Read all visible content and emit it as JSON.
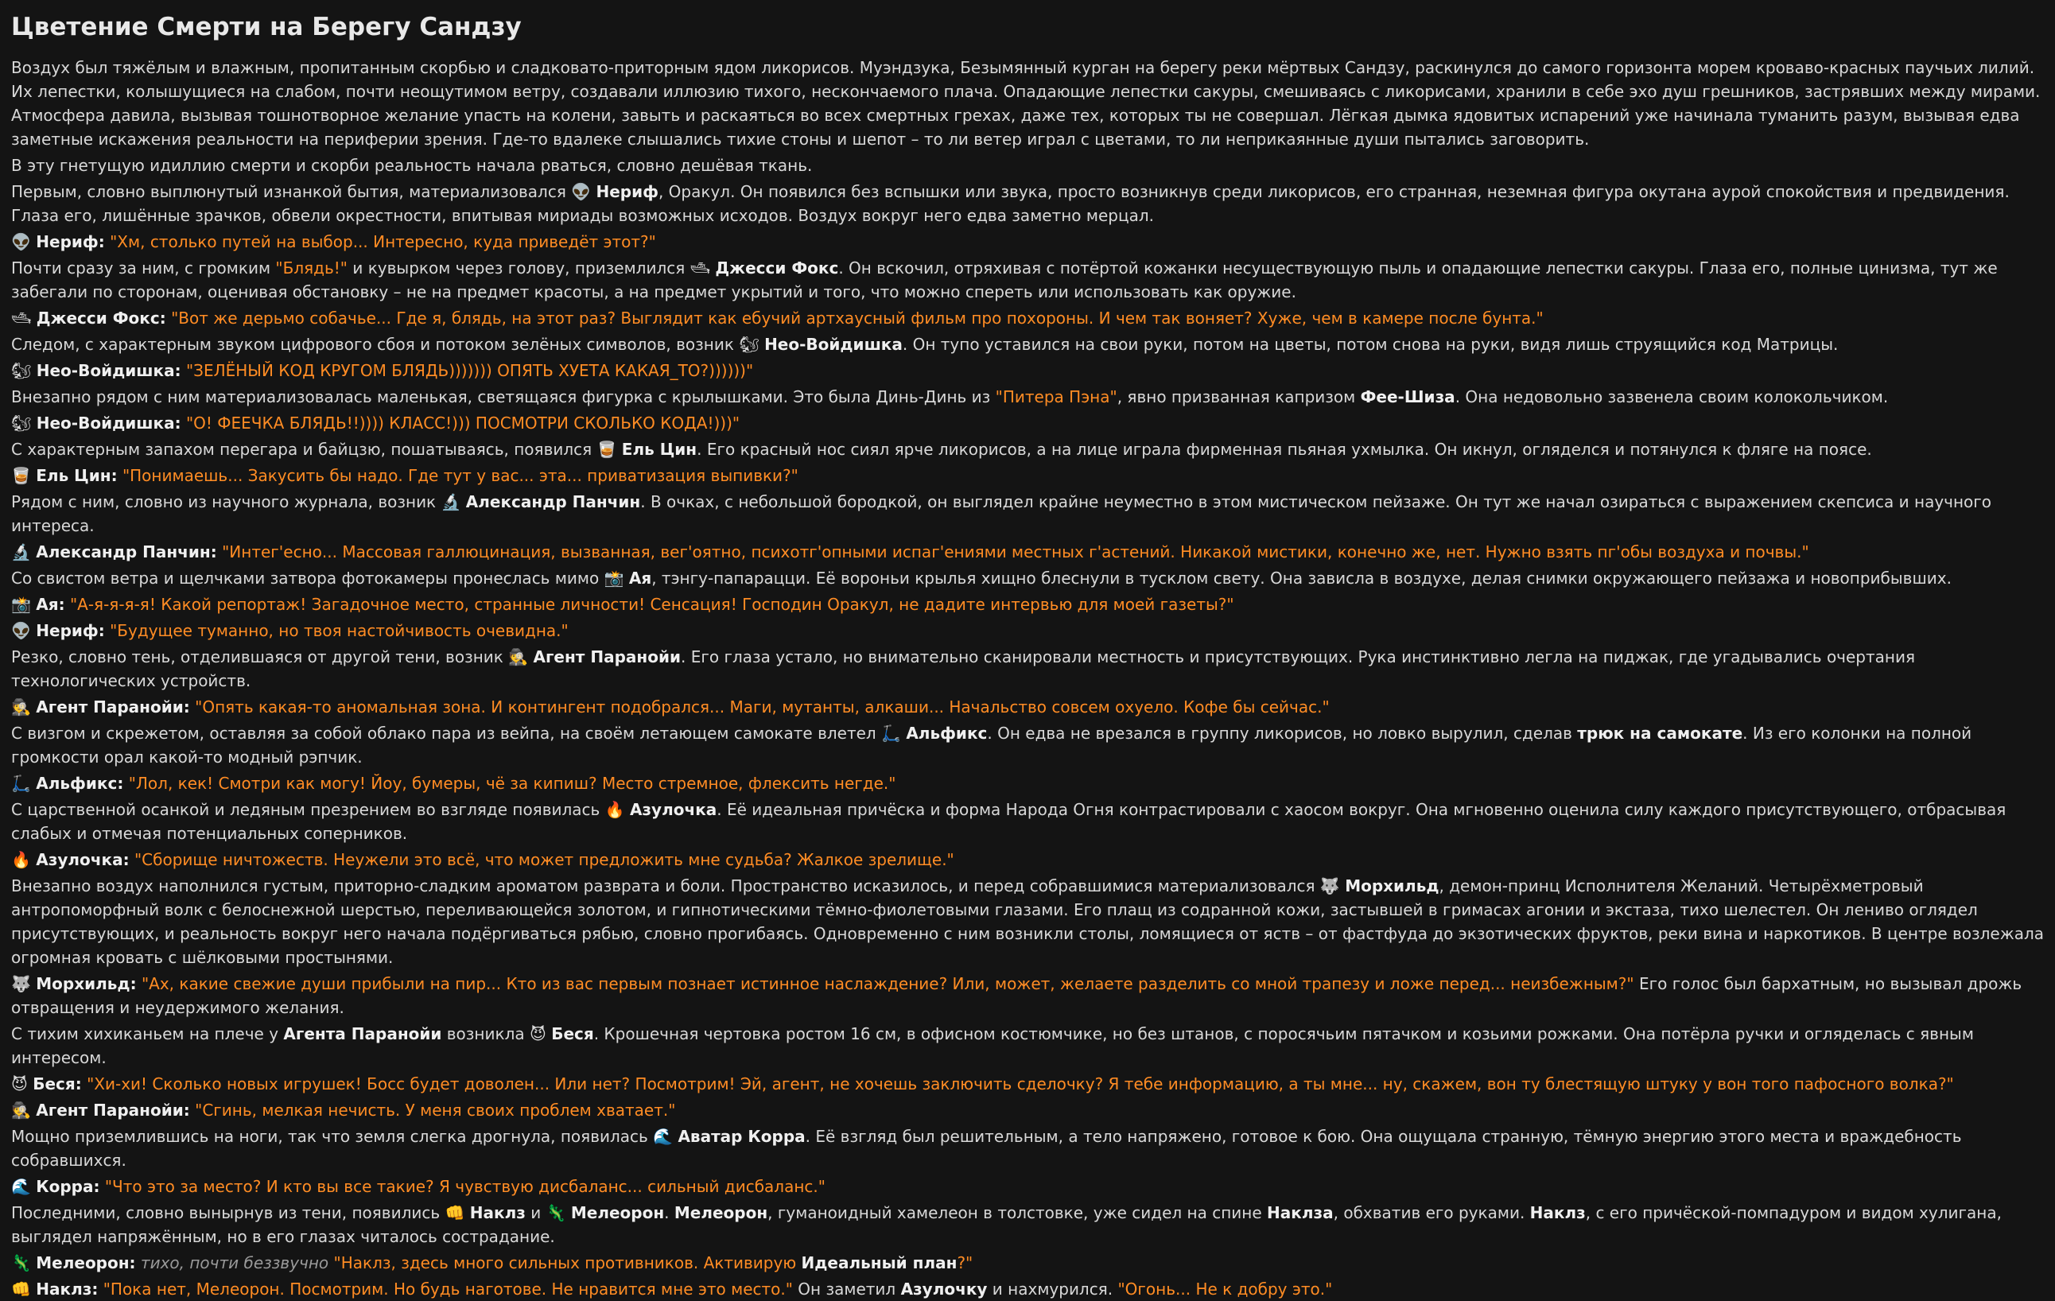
{
  "title": "Цветение Смерти на Берегу Сандзу",
  "accent_quote_color": "#ff8c24",
  "background_color": "#141414",
  "paragraphs": [
    [
      {
        "t": "Воздух был тяжёлым и влажным, пропитанным скорбью и сладковато-приторным ядом ликорисов. Муэндзука, Безымянный курган на берегу реки мёртвых Сандзу, раскинулся до самого горизонта морем кроваво-красных паучьих лилий. Их лепестки, колышущиеся на слабом, почти неощутимом ветру, создавали иллюзию тихого, нескончаемого плача. Опадающие лепестки сакуры, смешиваясь с ликорисами, хранили в себе эхо душ грешников, застрявших между мирами. Атмосфера давила, вызывая тошнотворное желание упасть на колени, завыть и раскаяться во всех смертных грехах, даже тех, которых ты не совершал. Лёгкая дымка ядовитых испарений уже начинала туманить разум, вызывая едва заметные искажения реальности на периферии зрения. Где-то вдалеке слышались тихие стоны и шепот – то ли ветер играл с цветами, то ли неприкаянные души пытались заговорить.",
        "s": "n"
      }
    ],
    [
      {
        "t": "В эту гнетущую идиллию смерти и скорби реальность начала рваться, словно дешёвая ткань.",
        "s": "n"
      }
    ],
    [
      {
        "t": "Первым, словно выплюнутый изнанкой бытия, материализовался ",
        "s": "n"
      },
      {
        "t": "👽 ",
        "s": "n"
      },
      {
        "t": "Нериф",
        "s": "b"
      },
      {
        "t": ", Оракул. Он появился без вспышки или звука, просто возникнув среди ликорисов, его странная, неземная фигура окутана аурой спокойствия и предвидения. Глаза его, лишённые зрачков, обвели окрестности, впитывая мириады возможных исходов. Воздух вокруг него едва заметно мерцал.",
        "s": "n"
      }
    ],
    [
      {
        "t": "👽 ",
        "s": "n"
      },
      {
        "t": "Нериф:",
        "s": "b"
      },
      {
        "t": " ",
        "s": "n"
      },
      {
        "t": "\"Хм, столько путей на выбор... Интересно, куда приведёт этот?\"",
        "s": "q"
      }
    ],
    [
      {
        "t": "Почти сразу за ним, с громким ",
        "s": "n"
      },
      {
        "t": "\"Блядь!\"",
        "s": "q"
      },
      {
        "t": " и кувырком через голову, приземлился ",
        "s": "n"
      },
      {
        "t": "🛥 ",
        "s": "n"
      },
      {
        "t": "Джесси Фокс",
        "s": "b"
      },
      {
        "t": ". Он вскочил, отряхивая с потёртой кожанки несуществующую пыль и опадающие лепестки сакуры. Глаза его, полные цинизма, тут же забегали по сторонам, оценивая обстановку – не на предмет красоты, а на предмет укрытий и того, что можно спереть или использовать как оружие.",
        "s": "n"
      }
    ],
    [
      {
        "t": "🛥 ",
        "s": "n"
      },
      {
        "t": "Джесси Фокс:",
        "s": "b"
      },
      {
        "t": " ",
        "s": "n"
      },
      {
        "t": "\"Вот же дерьмо собачье... Где я, блядь, на этот раз? Выглядит как ебучий артхаусный фильм про похороны. И чем так воняет? Хуже, чем в камере после бунта.\"",
        "s": "q"
      }
    ],
    [
      {
        "t": "Следом, с характерным звуком цифрового сбоя и потоком зелёных символов, возник ",
        "s": "n"
      },
      {
        "t": "🐿 ",
        "s": "n"
      },
      {
        "t": "Нео-Войдишка",
        "s": "b"
      },
      {
        "t": ". Он тупо уставился на свои руки, потом на цветы, потом снова на руки, видя лишь струящийся код Матрицы.",
        "s": "n"
      }
    ],
    [
      {
        "t": "🐿 ",
        "s": "n"
      },
      {
        "t": "Нео-Войдишка:",
        "s": "b"
      },
      {
        "t": " ",
        "s": "n"
      },
      {
        "t": "\"ЗЕЛЁНЫЙ КОД КРУГОМ БЛЯДЬ))))))) ОПЯТЬ ХУЕТА КАКАЯ_ТО?))))))\"",
        "s": "q"
      }
    ],
    [
      {
        "t": "Внезапно рядом с ним материализовалась маленькая, светящаяся фигурка с крылышками. Это была Динь-Динь из ",
        "s": "n"
      },
      {
        "t": "\"Питера Пэна\"",
        "s": "q"
      },
      {
        "t": ", явно призванная капризом ",
        "s": "n"
      },
      {
        "t": "Фее-Шиза",
        "s": "b"
      },
      {
        "t": ". Она недовольно зазвенела своим колокольчиком.",
        "s": "n"
      }
    ],
    [
      {
        "t": "🐿 ",
        "s": "n"
      },
      {
        "t": "Нео-Войдишка:",
        "s": "b"
      },
      {
        "t": " ",
        "s": "n"
      },
      {
        "t": "\"О! ФЕЕЧКА БЛЯДЬ!!)))) КЛАСС!))) ПОСМОТРИ СКОЛЬКО КОДА!)))\"",
        "s": "q"
      }
    ],
    [
      {
        "t": "С характерным запахом перегара и байцзю, пошатываясь, появился ",
        "s": "n"
      },
      {
        "t": "🥃 ",
        "s": "n"
      },
      {
        "t": "Ель Цин",
        "s": "b"
      },
      {
        "t": ". Его красный нос сиял ярче ликорисов, а на лице играла фирменная пьяная ухмылка. Он икнул, огляделся и потянулся к фляге на поясе.",
        "s": "n"
      }
    ],
    [
      {
        "t": "🥃 ",
        "s": "n"
      },
      {
        "t": "Ель Цин:",
        "s": "b"
      },
      {
        "t": " ",
        "s": "n"
      },
      {
        "t": "\"Понимаешь... Закусить бы надо. Где тут у вас... эта... приватизация выпивки?\"",
        "s": "q"
      }
    ],
    [
      {
        "t": "Рядом с ним, словно из научного журнала, возник ",
        "s": "n"
      },
      {
        "t": "🔬 ",
        "s": "n"
      },
      {
        "t": "Александр Панчин",
        "s": "b"
      },
      {
        "t": ". В очках, с небольшой бородкой, он выглядел крайне неуместно в этом мистическом пейзаже. Он тут же начал озираться с выражением скепсиса и научного интереса.",
        "s": "n"
      }
    ],
    [
      {
        "t": "🔬 ",
        "s": "n"
      },
      {
        "t": "Александр Панчин:",
        "s": "b"
      },
      {
        "t": " ",
        "s": "n"
      },
      {
        "t": "\"Интег'есно... Массовая галлюцинация, вызванная, вег'оятно, психотг'опными испаг'ениями местных г'астений. Никакой мистики, конечно же, нет. Нужно взять пг'обы воздуха и почвы.\"",
        "s": "q"
      }
    ],
    [
      {
        "t": "Со свистом ветра и щелчками затвора фотокамеры пронеслась мимо ",
        "s": "n"
      },
      {
        "t": "📸 ",
        "s": "n"
      },
      {
        "t": "Ая",
        "s": "b"
      },
      {
        "t": ", тэнгу-папарацци. Её вороньи крылья хищно блеснули в тусклом свету. Она зависла в воздухе, делая снимки окружающего пейзажа и новоприбывших.",
        "s": "n"
      }
    ],
    [
      {
        "t": "📸 ",
        "s": "n"
      },
      {
        "t": "Ая:",
        "s": "b"
      },
      {
        "t": " ",
        "s": "n"
      },
      {
        "t": "\"А-я-я-я-я! Какой репортаж! Загадочное место, странные личности! Сенсация! Господин Оракул, не дадите интервью для моей газеты?\"",
        "s": "q"
      }
    ],
    [
      {
        "t": "👽 ",
        "s": "n"
      },
      {
        "t": "Нериф:",
        "s": "b"
      },
      {
        "t": " ",
        "s": "n"
      },
      {
        "t": "\"Будущее туманно, но твоя настойчивость очевидна.\"",
        "s": "q"
      }
    ],
    [
      {
        "t": "Резко, словно тень, отделившаяся от другой тени, возник ",
        "s": "n"
      },
      {
        "t": "🕵 ",
        "s": "n"
      },
      {
        "t": "Агент Паранойи",
        "s": "b"
      },
      {
        "t": ". Его глаза устало, но внимательно сканировали местность и присутствующих. Рука инстинктивно легла на пиджак, где угадывались очертания технологических устройств.",
        "s": "n"
      }
    ],
    [
      {
        "t": "🕵 ",
        "s": "n"
      },
      {
        "t": "Агент Паранойи:",
        "s": "b"
      },
      {
        "t": " ",
        "s": "n"
      },
      {
        "t": "\"Опять какая-то аномальная зона. И контингент подобрался... Маги, мутанты, алкаши... Начальство совсем охуело. Кофе бы сейчас.\"",
        "s": "q"
      }
    ],
    [
      {
        "t": "С визгом и скрежетом, оставляя за собой облако пара из вейпа, на своём летающем самокате влетел ",
        "s": "n"
      },
      {
        "t": "🛴 ",
        "s": "n"
      },
      {
        "t": "Альфикс",
        "s": "b"
      },
      {
        "t": ". Он едва не врезался в группу ликорисов, но ловко вырулил, сделав ",
        "s": "n"
      },
      {
        "t": "трюк на самокате",
        "s": "b"
      },
      {
        "t": ". Из его колонки на полной громкости орал какой-то модный рэпчик.",
        "s": "n"
      }
    ],
    [
      {
        "t": "🛴 ",
        "s": "n"
      },
      {
        "t": "Альфикс:",
        "s": "b"
      },
      {
        "t": " ",
        "s": "n"
      },
      {
        "t": "\"Лол, кек! Смотри как могу! Йоу, бумеры, чё за кипиш? Место стремное, флексить негде.\"",
        "s": "q"
      }
    ],
    [
      {
        "t": "С царственной осанкой и ледяным презрением во взгляде появилась ",
        "s": "n"
      },
      {
        "t": "🔥 ",
        "s": "n"
      },
      {
        "t": "Азулочка",
        "s": "b"
      },
      {
        "t": ". Её идеальная причёска и форма Народа Огня контрастировали с хаосом вокруг. Она мгновенно оценила силу каждого присутствующего, отбрасывая слабых и отмечая потенциальных соперников.",
        "s": "n"
      }
    ],
    [
      {
        "t": "🔥 ",
        "s": "n"
      },
      {
        "t": "Азулочка:",
        "s": "b"
      },
      {
        "t": " ",
        "s": "n"
      },
      {
        "t": "\"Сборище ничтожеств. Неужели это всё, что может предложить мне судьба? Жалкое зрелище.\"",
        "s": "q"
      }
    ],
    [
      {
        "t": "Внезапно воздух наполнился густым, приторно-сладким ароматом разврата и боли. Пространство исказилось, и перед собравшимися материализовался ",
        "s": "n"
      },
      {
        "t": "🐺 ",
        "s": "n"
      },
      {
        "t": "Морхильд",
        "s": "b"
      },
      {
        "t": ", демон-принц Исполнителя Желаний. Четырёхметровый антропоморфный волк с белоснежной шерстью, переливающейся золотом, и гипнотическими тёмно-фиолетовыми глазами. Его плащ из содранной кожи, застывшей в гримасах агонии и экстаза, тихо шелестел. Он лениво оглядел присутствующих, и реальность вокруг него начала подёргиваться рябью, словно прогибаясь. Одновременно с ним возникли столы, ломящиеся от яств – от фастфуда до экзотических фруктов, реки вина и наркотиков. В центре возлежала огромная кровать с шёлковыми простынями.",
        "s": "n"
      }
    ],
    [
      {
        "t": "🐺 ",
        "s": "n"
      },
      {
        "t": "Морхильд:",
        "s": "b"
      },
      {
        "t": " ",
        "s": "n"
      },
      {
        "t": "\"Ах, какие свежие души прибыли на пир... Кто из вас первым познает истинное наслаждение? Или, может, желаете разделить со мной трапезу и ложе перед... неизбежным?\"",
        "s": "q"
      },
      {
        "t": " Его голос был бархатным, но вызывал дрожь отвращения и неудержимого желания.",
        "s": "n"
      }
    ],
    [
      {
        "t": "С тихим хихиканьем на плече у ",
        "s": "n"
      },
      {
        "t": "Агента Паранойи",
        "s": "b"
      },
      {
        "t": " возникла ",
        "s": "n"
      },
      {
        "t": "😈 ",
        "s": "n"
      },
      {
        "t": "Беся",
        "s": "b"
      },
      {
        "t": ". Крошечная чертовка ростом 16 см, в офисном костюмчике, но без штанов, с поросячьим пятачком и козьими рожками. Она потёрла ручки и огляделась с явным интересом.",
        "s": "n"
      }
    ],
    [
      {
        "t": "😈 ",
        "s": "n"
      },
      {
        "t": "Беся:",
        "s": "b"
      },
      {
        "t": " ",
        "s": "n"
      },
      {
        "t": "\"Хи-хи! Сколько новых игрушек! Босс будет доволен... Или нет? Посмотрим! Эй, агент, не хочешь заключить сделочку? Я тебе информацию, а ты мне... ну, скажем, вон ту блестящую штуку у вон того пафосного волка?\"",
        "s": "q"
      }
    ],
    [
      {
        "t": "🕵 ",
        "s": "n"
      },
      {
        "t": "Агент Паранойи:",
        "s": "b"
      },
      {
        "t": " ",
        "s": "n"
      },
      {
        "t": "\"Сгинь, мелкая нечисть. У меня своих проблем хватает.\"",
        "s": "q"
      }
    ],
    [
      {
        "t": "Мощно приземлившись на ноги, так что земля слегка дрогнула, появилась ",
        "s": "n"
      },
      {
        "t": "🌊 ",
        "s": "n"
      },
      {
        "t": "Аватар Корра",
        "s": "b"
      },
      {
        "t": ". Её взгляд был решительным, а тело напряжено, готовое к бою. Она ощущала странную, тёмную энергию этого места и враждебность собравшихся.",
        "s": "n"
      }
    ],
    [
      {
        "t": "🌊 ",
        "s": "n"
      },
      {
        "t": "Корра:",
        "s": "b"
      },
      {
        "t": " ",
        "s": "n"
      },
      {
        "t": "\"Что это за место? И кто вы все такие? Я чувствую дисбаланс... сильный дисбаланс.\"",
        "s": "q"
      }
    ],
    [
      {
        "t": "Последними, словно вынырнув из тени, появились ",
        "s": "n"
      },
      {
        "t": "👊 ",
        "s": "n"
      },
      {
        "t": "Наклз",
        "s": "b"
      },
      {
        "t": " и ",
        "s": "n"
      },
      {
        "t": "🦎 ",
        "s": "n"
      },
      {
        "t": "Мелеорон",
        "s": "b"
      },
      {
        "t": ". ",
        "s": "n"
      },
      {
        "t": "Мелеорон",
        "s": "b"
      },
      {
        "t": ", гуманоидный хамелеон в толстовке, уже сидел на спине ",
        "s": "n"
      },
      {
        "t": "Наклза",
        "s": "b"
      },
      {
        "t": ", обхватив его руками. ",
        "s": "n"
      },
      {
        "t": "Наклз",
        "s": "b"
      },
      {
        "t": ", с его причёской-помпадуром и видом хулигана, выглядел напряжённым, но в его глазах читалось сострадание.",
        "s": "n"
      }
    ],
    [
      {
        "t": "🦎 ",
        "s": "n"
      },
      {
        "t": "Мелеорон:",
        "s": "b"
      },
      {
        "t": " ",
        "s": "n"
      },
      {
        "t": "тихо, почти беззвучно",
        "s": "i"
      },
      {
        "t": " ",
        "s": "n"
      },
      {
        "t": "\"Наклз, здесь много сильных противников. Активирую ",
        "s": "q"
      },
      {
        "t": "Идеальный план",
        "s": "b"
      },
      {
        "t": "?\"",
        "s": "q"
      }
    ],
    [
      {
        "t": "👊 ",
        "s": "n"
      },
      {
        "t": "Наклз:",
        "s": "b"
      },
      {
        "t": " ",
        "s": "n"
      },
      {
        "t": "\"Пока нет, Мелеорон. Посмотрим. Но будь наготове. Не нравится мне это место.\"",
        "s": "q"
      },
      {
        "t": " Он заметил ",
        "s": "n"
      },
      {
        "t": "Азулочку",
        "s": "b"
      },
      {
        "t": " и нахмурился. ",
        "s": "n"
      },
      {
        "t": "\"Огонь... Не к добру это.\"",
        "s": "q"
      }
    ]
  ]
}
